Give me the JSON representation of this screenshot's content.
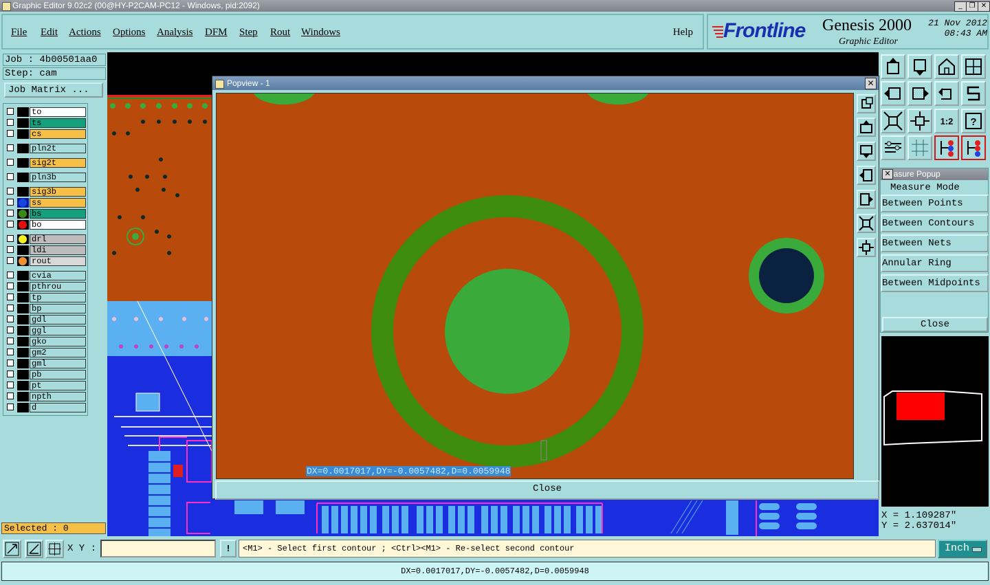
{
  "window": {
    "title": "Graphic Editor 9.02c2 (00@HY-P2CAM-PC12 - Windows, pid:2092)",
    "controls": [
      "_",
      "❐",
      "✕"
    ]
  },
  "menu": {
    "items": [
      "File",
      "Edit",
      "Actions",
      "Options",
      "Analysis",
      "DFM",
      "Step",
      "Rout",
      "Windows"
    ],
    "help": "Help"
  },
  "brand": {
    "logo": "Frontline",
    "product": "Genesis 2000",
    "subtitle": "Graphic Editor",
    "date": "21 Nov 2012",
    "time": "08:43 AM"
  },
  "job": {
    "job_line": "Job : 4b00501aa0",
    "step_line": "Step: cam",
    "matrix_button": "Job Matrix ..."
  },
  "layers": [
    {
      "name": "to",
      "color": "#ffffff",
      "swatch": "#000000",
      "dot": ""
    },
    {
      "name": "ts",
      "color": "#13a07c",
      "swatch": "#000000",
      "dot": ""
    },
    {
      "name": "cs",
      "color": "#f6c046",
      "swatch": "#000000",
      "dot": ""
    },
    {
      "name": "pln2t",
      "color": "#a8dcdc",
      "swatch": "#000000",
      "dot": ""
    },
    {
      "name": "sig2t",
      "color": "#f6c046",
      "swatch": "#000000",
      "dot": ""
    },
    {
      "name": "pln3b",
      "color": "#a8dcdc",
      "swatch": "#000000",
      "dot": ""
    },
    {
      "name": "sig3b",
      "color": "#f6c046",
      "swatch": "#000000",
      "dot": ""
    },
    {
      "name": "ss",
      "color": "#f6c046",
      "swatch": "#0a1a9a",
      "dot": "#1646e0"
    },
    {
      "name": "bs",
      "color": "#13a07c",
      "swatch": "#000000",
      "dot": "#3a8a1a"
    },
    {
      "name": "bo",
      "color": "#ffffff",
      "swatch": "#000000",
      "dot": "#e01010"
    },
    {
      "name": "drl",
      "color": "#bcbcbc",
      "swatch": "#000000",
      "dot": "#f0f020"
    },
    {
      "name": "ldi",
      "color": "#bcbcbc",
      "swatch": "#000000",
      "dot": ""
    },
    {
      "name": "rout",
      "color": "#d8d8d8",
      "swatch": "#000000",
      "dot": "#f09030"
    },
    {
      "name": "cvia",
      "color": "#a8dcdc",
      "swatch": "#000000",
      "dot": ""
    },
    {
      "name": "pthrou",
      "color": "#a8dcdc",
      "swatch": "#000000",
      "dot": ""
    },
    {
      "name": "tp",
      "color": "#a8dcdc",
      "swatch": "#000000",
      "dot": ""
    },
    {
      "name": "bp",
      "color": "#a8dcdc",
      "swatch": "#000000",
      "dot": ""
    },
    {
      "name": "gdl",
      "color": "#a8dcdc",
      "swatch": "#000000",
      "dot": ""
    },
    {
      "name": "ggl",
      "color": "#a8dcdc",
      "swatch": "#000000",
      "dot": ""
    },
    {
      "name": "gko",
      "color": "#a8dcdc",
      "swatch": "#000000",
      "dot": ""
    },
    {
      "name": "gm2",
      "color": "#a8dcdc",
      "swatch": "#000000",
      "dot": ""
    },
    {
      "name": "gml",
      "color": "#a8dcdc",
      "swatch": "#000000",
      "dot": ""
    },
    {
      "name": "pb",
      "color": "#a8dcdc",
      "swatch": "#000000",
      "dot": ""
    },
    {
      "name": "pt",
      "color": "#a8dcdc",
      "swatch": "#000000",
      "dot": ""
    },
    {
      "name": "npth",
      "color": "#a8dcdc",
      "swatch": "#000000",
      "dot": ""
    },
    {
      "name": "d",
      "color": "#a8dcdc",
      "swatch": "#000000",
      "dot": ""
    }
  ],
  "selected": "Selected : 0",
  "popview": {
    "title": "Popview - 1",
    "readout": "DX=0.0017017,DY=-0.0057482,D=0.0059948",
    "close": "Close"
  },
  "measure": {
    "title": "Measure Popup",
    "mode_label": "Measure Mode",
    "options": [
      "Between Points",
      "Between Contours",
      "Between Nets",
      "Annular Ring",
      "Between Midpoints"
    ],
    "close": "Close"
  },
  "coords": {
    "x": "X = 1.109287\"",
    "y": "Y = 2.637014\""
  },
  "bottom": {
    "xy_label": "X Y :",
    "xy_value": "",
    "warn": "!",
    "prompt": "<M1> - Select first contour ; <Ctrl><M1> - Re-select second contour",
    "units": "Inch"
  },
  "status": "DX=0.0017017,DY=-0.0057482,D=0.0059948",
  "colors": {
    "panel": "#a8dcdc",
    "copper": "#b84a0c",
    "pad_green": "#3aaa3a",
    "ring_green": "#3e8c0e",
    "board_blue": "#1a2ee0"
  }
}
